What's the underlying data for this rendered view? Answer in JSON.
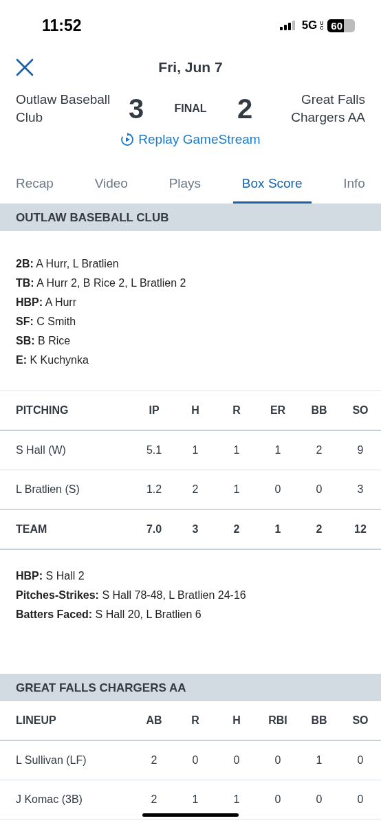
{
  "status_bar": {
    "time": "11:52",
    "network": "5G",
    "network_suffix": "UC",
    "battery": "60"
  },
  "header": {
    "date": "Fri, Jun 7"
  },
  "score": {
    "away_team": "Outlaw Baseball Club",
    "away_score": "3",
    "status": "FINAL",
    "home_score": "2",
    "home_team": "Great Falls Chargers AA",
    "replay_link": "Replay GameStream"
  },
  "tabs": [
    {
      "label": "Recap",
      "selected": false
    },
    {
      "label": "Video",
      "selected": false
    },
    {
      "label": "Plays",
      "selected": false
    },
    {
      "label": "Box Score",
      "selected": true
    },
    {
      "label": "Info",
      "selected": false
    }
  ],
  "sections": [
    {
      "title": "OUTLAW BASEBALL CLUB",
      "batting_notes": [
        "**2B:** A Hurr, L Bratlien",
        "**TB:** A Hurr 2, B Rice 2, L Bratlien 2",
        "**HBP:** A Hurr",
        "**SF:** C Smith",
        "**SB:** B Rice",
        "**E:** K Kuchynka"
      ],
      "table": {
        "columns": [
          "PITCHING",
          "IP",
          "H",
          "R",
          "ER",
          "BB",
          "SO"
        ],
        "rows": [
          {
            "kind": "player",
            "cells": [
              "S Hall (W)",
              "5.1",
              "1",
              "1",
              "1",
              "2",
              "9"
            ]
          },
          {
            "kind": "player",
            "cells": [
              "L Bratlien (S)",
              "1.2",
              "2",
              "1",
              "0",
              "0",
              "3"
            ]
          },
          {
            "kind": "total",
            "cells": [
              "TEAM",
              "7.0",
              "3",
              "2",
              "1",
              "2",
              "12"
            ]
          }
        ]
      },
      "pitching_notes": [
        "**HBP:** S Hall 2",
        "**Pitches-Strikes:** S Hall 78-48, L Bratlien 24-16",
        "**Batters Faced:** S Hall 20, L Bratlien 6"
      ]
    },
    {
      "title": "GREAT FALLS CHARGERS AA",
      "table": {
        "columns": [
          "LINEUP",
          "AB",
          "R",
          "H",
          "RBI",
          "BB",
          "SO"
        ],
        "rows": [
          {
            "kind": "player",
            "cells": [
              "L Sullivan (LF)",
              "2",
              "0",
              "0",
              "0",
              "1",
              "0"
            ]
          },
          {
            "kind": "player",
            "cells": [
              "J Komac (3B)",
              "2",
              "1",
              "1",
              "0",
              "0",
              "0"
            ]
          }
        ]
      }
    }
  ]
}
